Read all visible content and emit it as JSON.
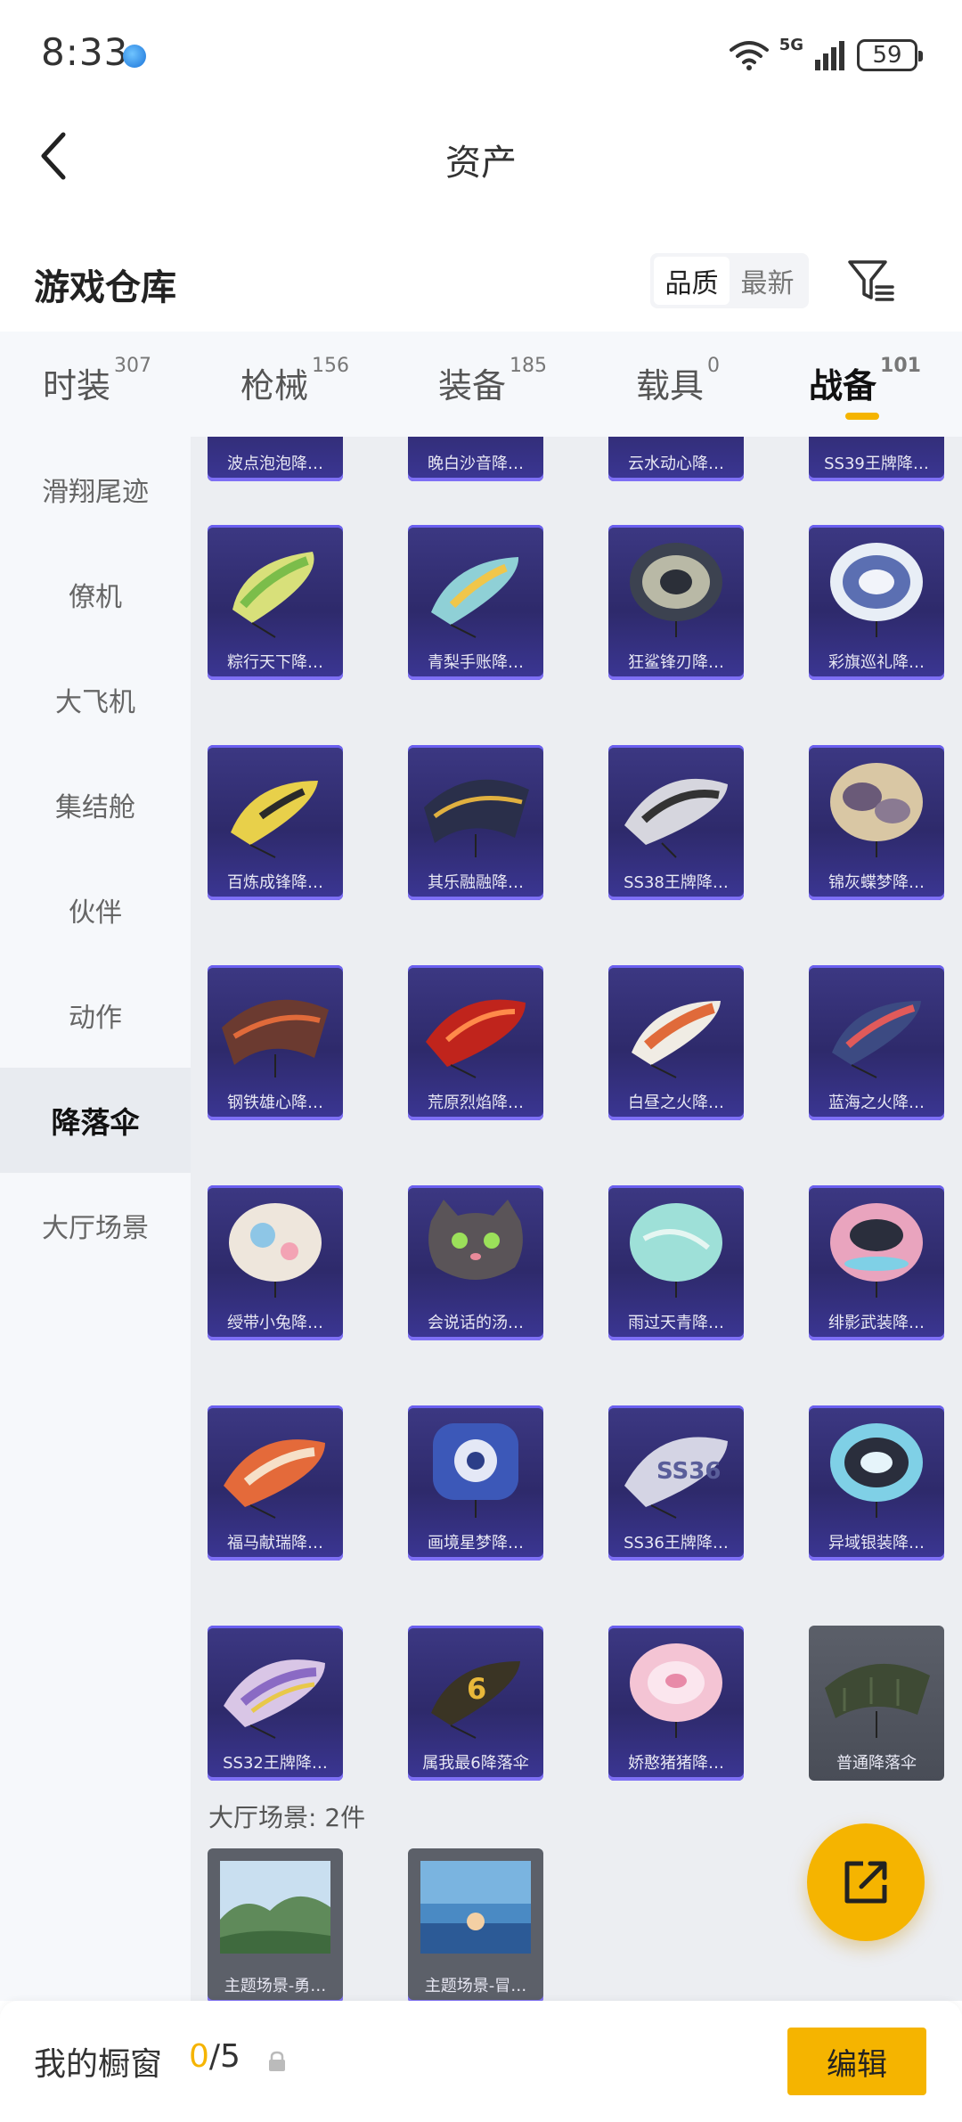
{
  "status": {
    "time": "8:33",
    "network": "5G",
    "battery": "59"
  },
  "header": {
    "title": "资产"
  },
  "section": {
    "title": "游戏仓库",
    "sort_options": [
      "品质",
      "最新"
    ],
    "sort_selected": "品质"
  },
  "tabs": [
    {
      "label": "时装",
      "count": "307"
    },
    {
      "label": "枪械",
      "count": "156"
    },
    {
      "label": "装备",
      "count": "185"
    },
    {
      "label": "载具",
      "count": "0"
    },
    {
      "label": "战备",
      "count": "101"
    }
  ],
  "active_tab": "战备",
  "sidebar": {
    "items": [
      "滑翔尾迹",
      "僚机",
      "大飞机",
      "集结舱",
      "伙伴",
      "动作",
      "降落伞",
      "大厅场景"
    ],
    "active": "降落伞"
  },
  "grid": {
    "partial_row": [
      "波点泡泡降…",
      "晚白沙音降…",
      "云水动心降…",
      "SS39王牌降…"
    ],
    "rows": [
      [
        "粽行天下降…",
        "青梨手账降…",
        "狂鲨锋刃降…",
        "彩旗巡礼降…"
      ],
      [
        "百炼成锋降…",
        "其乐融融降…",
        "SS38王牌降…",
        "锦灰蝶梦降…"
      ],
      [
        "钢铁雄心降…",
        "荒原烈焰降…",
        "白昼之火降…",
        "蓝海之火降…"
      ],
      [
        "绶带小兔降…",
        "会说话的汤…",
        "雨过天青降…",
        "绯影武装降…"
      ],
      [
        "福马献瑞降…",
        "画境星梦降…",
        "SS36王牌降…",
        "异域银装降…"
      ],
      [
        "SS32王牌降…",
        "属我最6降落伞",
        "娇憨猪猪降…",
        "普通降落伞"
      ]
    ],
    "scene_group_title": "大厅场景: 2件",
    "scenes": [
      "主题场景-勇…",
      "主题场景-冒…"
    ]
  },
  "bottom": {
    "label": "我的橱窗",
    "current": "0",
    "total": "/5",
    "edit_label": "编辑"
  },
  "colors": {
    "accent": "#f5b400",
    "card_bg": "#2e2a6b",
    "card_stripe": "#7f6df6"
  }
}
